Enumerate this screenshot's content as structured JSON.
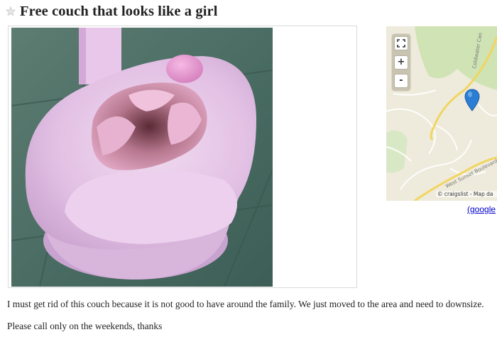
{
  "posting": {
    "title": "Free couch that looks like a girl",
    "body": [
      "I must get rid of this couch because it is not good to have around the family. We just moved to the area and need to downsize.",
      "Please call only on the weekends, thanks"
    ]
  },
  "map": {
    "fullscreen_icon": "fullscreen-icon",
    "zoom_in_label": "+",
    "zoom_out_label": "-",
    "street_labels": [
      "Coldwater Can",
      "West Sunset Boulevard"
    ],
    "attribution": "© craigslist - Map da",
    "link_label": "(google"
  },
  "icons": {
    "favorite": "star-icon",
    "location": "map-pin-icon"
  },
  "colors": {
    "link": "#0000cc",
    "pin": "#2b7dd3",
    "map_road": "#f2d560",
    "map_park": "#cfe3b4"
  }
}
